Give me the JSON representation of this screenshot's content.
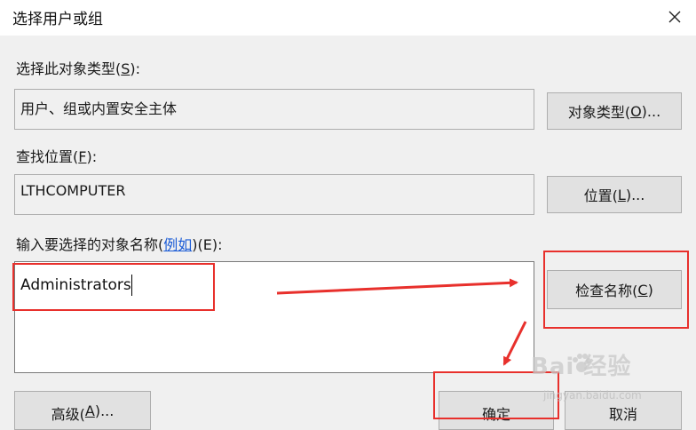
{
  "window": {
    "title": "选择用户或组"
  },
  "object_type": {
    "label_prefix": "选择此对象类型(",
    "label_key": "S",
    "label_suffix": "):",
    "value": "用户、组或内置安全主体",
    "button_prefix": "对象类型(",
    "button_key": "O",
    "button_suffix": ")..."
  },
  "location": {
    "label_prefix": "查找位置(",
    "label_key": "F",
    "label_suffix": "):",
    "value": "LTHCOMPUTER",
    "button_prefix": "位置(",
    "button_key": "L",
    "button_suffix": ")..."
  },
  "names": {
    "label_prefix": "输入要选择的对象名称(",
    "label_link": "例如",
    "label_suffix": ")(E):",
    "value": "Administrators"
  },
  "buttons": {
    "check_names_prefix": "检查名称(",
    "check_names_key": "C",
    "check_names_suffix": ")",
    "advanced_prefix": "高级(",
    "advanced_key": "A",
    "advanced_suffix": ")...",
    "ok": "确定",
    "cancel": "取消"
  },
  "watermark": {
    "main": "Bai 经验",
    "sub": "jingyan.baidu.com"
  },
  "colors": {
    "annotation": "#e8302c",
    "link": "#1a5bd6",
    "background": "#f0f0f0"
  },
  "icons": {
    "close": "close-icon",
    "watermark_paw": "baidu-paw-icon"
  }
}
